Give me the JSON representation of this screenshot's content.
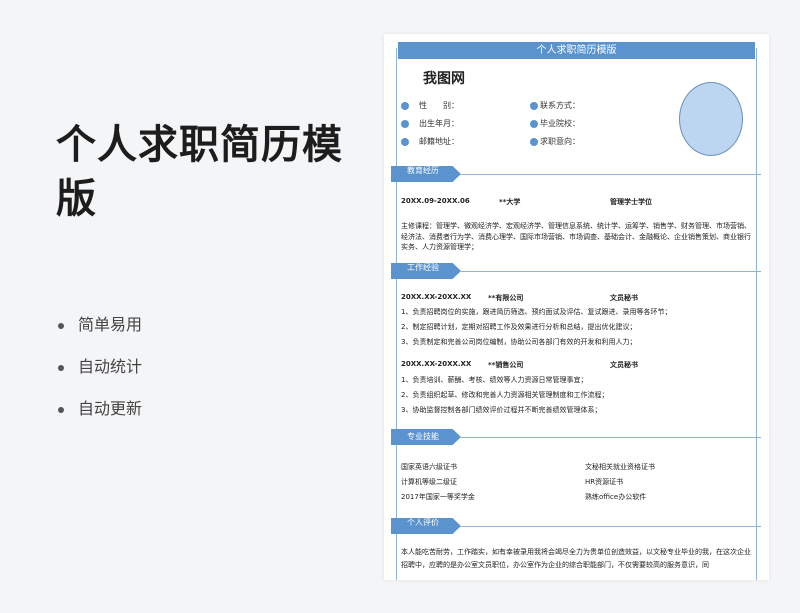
{
  "promo": {
    "title": "个人求职简历模版",
    "features": [
      "简单易用",
      "自动统计",
      "自动更新"
    ]
  },
  "resume": {
    "banner": "个人求职简历模版",
    "name": "我图网",
    "info": {
      "gender": "性　　别：",
      "contact": "联系方式：",
      "birth": "出生年月：",
      "school": "毕业院校：",
      "native": "邮籍地址：",
      "intention": "求职意向："
    },
    "sections": {
      "education": "教育经历",
      "work": "工作经验",
      "skills": "专业技能",
      "evaluation": "个人评价"
    },
    "education": {
      "period": "20XX.09-20XX.06",
      "school": "**大学",
      "degree": "管理学士学位",
      "courses": "主修课程：管理学、微观经济学、宏观经济学、管理信息系统、统计学、运筹学、销售学、财务管理、市场营销、经济法、消费者行为学、消费心理学、国际市场营销、市场调查、基础会计、金融概论、企业销售策划、商业银行实务、人力资源管理学；"
    },
    "jobs": [
      {
        "period": "20XX.XX-20XX.XX",
        "company": "**有限公司",
        "role": "文员秘书",
        "duties": [
          "1、负责招聘岗位的实施，跟进简历筛选、预约面试及评估、复试跟进、录用等各环节；",
          "2、制定招聘计划，定期对招聘工作及效果进行分析和总结，提出优化建议；",
          "3、负责制定和完善公司岗位编制，协助公司各部门有效的开发和利用人力；"
        ]
      },
      {
        "period": "20XX.XX-20XX.XX",
        "company": "**销售公司",
        "role": "文员秘书",
        "duties": [
          "1、负责培训、薪酬、考核、绩效等人力资源日常管理事宜；",
          "2、负责组织起草、修改和完善人力资源相关管理制度和工作流程；",
          "3、协助监督控制各部门绩效评价过程并不断完善绩效管理体系；"
        ]
      }
    ],
    "skills": [
      "国家英语六级证书",
      "文秘相关就业资格证书",
      "计算机等级二级证",
      "HR资源证书",
      "2017年国家一等奖学金",
      "熟练office办公软件"
    ],
    "evaluation": "本人能吃苦耐劳，工作踏实，如有幸被录用我将会竭尽全力为贵单位创造效益，以文秘专业毕业的我，在这次企业招聘中，应聘的是办公室文员职位，办公室作为企业的综合职能部门，不仅需要较高的服务意识，同"
  },
  "colors": {
    "accent": "#5b93cf",
    "photo": "#bcd6f2"
  }
}
